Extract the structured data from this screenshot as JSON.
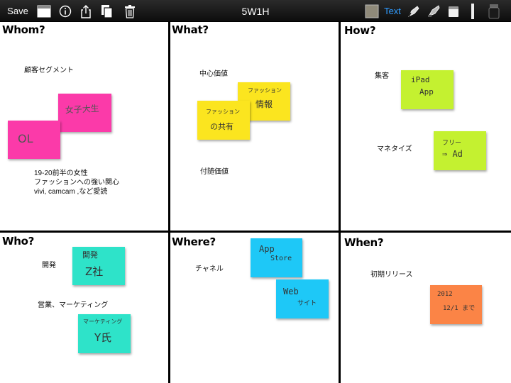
{
  "toolbar": {
    "save_label": "Save",
    "title": "5W1H",
    "text_label": "Text",
    "icons": [
      "page-icon",
      "info-icon",
      "share-icon",
      "copy-icon",
      "trash-icon",
      "paper-color-icon",
      "pen-icon",
      "marker-icon",
      "eraser-icon",
      "line-width-icon",
      "ink-icon"
    ]
  },
  "colors": {
    "pink": "#fb3aa9",
    "yellow": "#fbe51f",
    "green": "#c4f130",
    "cyan": "#2ee3c9",
    "blue": "#1ec8f7",
    "orange": "#fb8446",
    "accent": "#2f9bff"
  },
  "cells": {
    "whom": {
      "heading": "Whom?",
      "segment": "顧客セグメント",
      "desc": [
        "19-20前半の女性",
        "ファッションへの強い関心",
        "vivi, camcam ,など愛読"
      ],
      "notes": {
        "joshidai": "女子大生",
        "ol": "OL"
      }
    },
    "what": {
      "heading": "What?",
      "core": "中心価値",
      "sub": "付随価値",
      "notes": {
        "info": [
          "ファッション",
          "情報"
        ],
        "share": [
          "ファッション",
          "の共有"
        ]
      }
    },
    "how": {
      "heading": "How?",
      "acquire": "集客",
      "monetize": "マネタイズ",
      "notes": {
        "ipad": [
          "iPad",
          "App"
        ],
        "free": [
          "フリー",
          "⇒ Ad"
        ]
      }
    },
    "who": {
      "heading": "Who?",
      "dev": "開発",
      "sales": "営業、マーケティング",
      "notes": {
        "dev": [
          "開発",
          "Z社"
        ],
        "mkt": [
          "マーケティング",
          "Y氏"
        ]
      }
    },
    "where": {
      "heading": "Where?",
      "channel": "チャネル",
      "notes": {
        "appstore": [
          "App",
          "Store"
        ],
        "web": [
          "Web",
          "サイト"
        ]
      }
    },
    "when": {
      "heading": "When?",
      "release": "初期リリース",
      "notes": {
        "date": [
          "2012",
          "12/1 まで"
        ]
      }
    }
  }
}
